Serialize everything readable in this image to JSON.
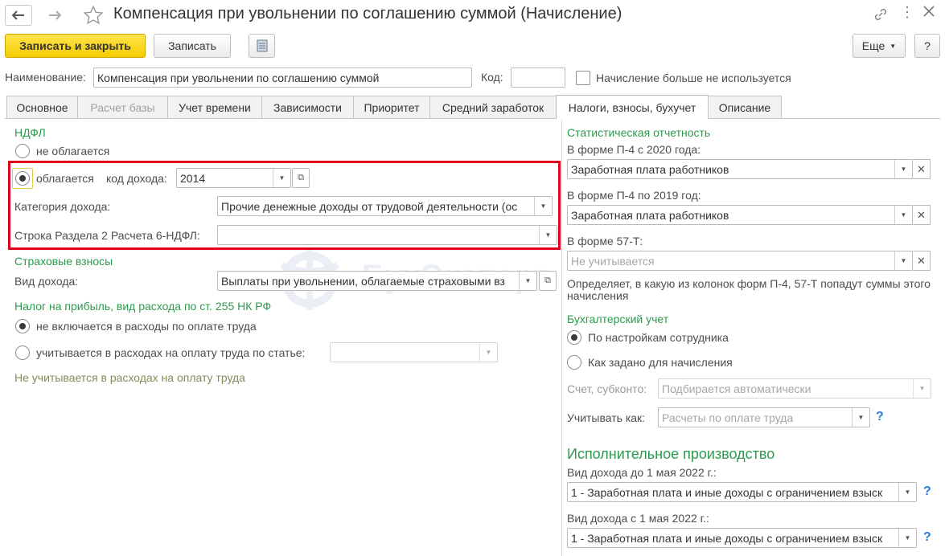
{
  "window": {
    "title": "Компенсация при увольнении по соглашению суммой (Начисление)"
  },
  "toolbar": {
    "save_close": "Записать и закрыть",
    "save": "Записать",
    "more": "Еще",
    "help": "?"
  },
  "header": {
    "name_label": "Наименование:",
    "name_value": "Компенсация при увольнении по соглашению суммой",
    "code_label": "Код:",
    "code_value": "",
    "unused_label": "Начисление больше не используется"
  },
  "tabs": [
    {
      "label": "Основное"
    },
    {
      "label": "Расчет базы"
    },
    {
      "label": "Учет времени"
    },
    {
      "label": "Зависимости"
    },
    {
      "label": "Приоритет"
    },
    {
      "label": "Средний заработок"
    },
    {
      "label": "Налоги, взносы, бухучет"
    },
    {
      "label": "Описание"
    }
  ],
  "ndfl": {
    "section": "НДФЛ",
    "not_taxed": "не облагается",
    "taxed": "облагается",
    "income_code_label": "код дохода:",
    "income_code_value": "2014",
    "category_label": "Категория дохода:",
    "category_value": "Прочие денежные доходы от трудовой деятельности (ос",
    "line_label": "Строка Раздела 2 Расчета 6-НДФЛ:",
    "line_value": ""
  },
  "insurance": {
    "section": "Страховые взносы",
    "income_type_label": "Вид дохода:",
    "income_type_value": "Выплаты при увольнении, облагаемые страховыми вз"
  },
  "profit_tax": {
    "section": "Налог на прибыль, вид расхода по ст. 255 НК РФ",
    "option1": "не включается в расходы по оплате труда",
    "option2": "учитывается в расходах на оплату труда по статье:",
    "article_value": "",
    "note": "Не учитывается в расходах на оплату труда"
  },
  "stats": {
    "section": "Статистическая отчетность",
    "p4_2020_label": "В форме П-4 с 2020 года:",
    "p4_2020_value": "Заработная плата работников",
    "p4_2019_label": "В форме П-4 по 2019 год:",
    "p4_2019_value": "Заработная плата работников",
    "f57_label": "В форме 57-Т:",
    "f57_value": "Не учитывается",
    "note": "Определяет, в какую из колонок форм П-4, 57-Т попадут суммы этого начисления"
  },
  "accounting": {
    "section": "Бухгалтерский учет",
    "option1": "По настройкам сотрудника",
    "option2": "Как задано для начисления",
    "account_label": "Счет, субконто:",
    "account_value": "Подбирается автоматически",
    "account_as_label": "Учитывать как:",
    "account_as_value": "Расчеты по оплате труда"
  },
  "enforcement": {
    "section": "Исполнительное производство",
    "before_label": "Вид дохода до 1 мая 2022 г.:",
    "before_value": "1 - Заработная плата и иные доходы с ограничением взыск",
    "after_label": "Вид дохода с 1 мая 2022 г.:",
    "after_value": "1 - Заработная плата и иные доходы с ограничением взыск"
  },
  "watermark": "БухЭксперт",
  "colors": {
    "accent_green": "#2d9a4d",
    "highlight_red": "#e0001b",
    "primary_yellow": "#f5cc00",
    "help_blue": "#2a7bd6"
  }
}
